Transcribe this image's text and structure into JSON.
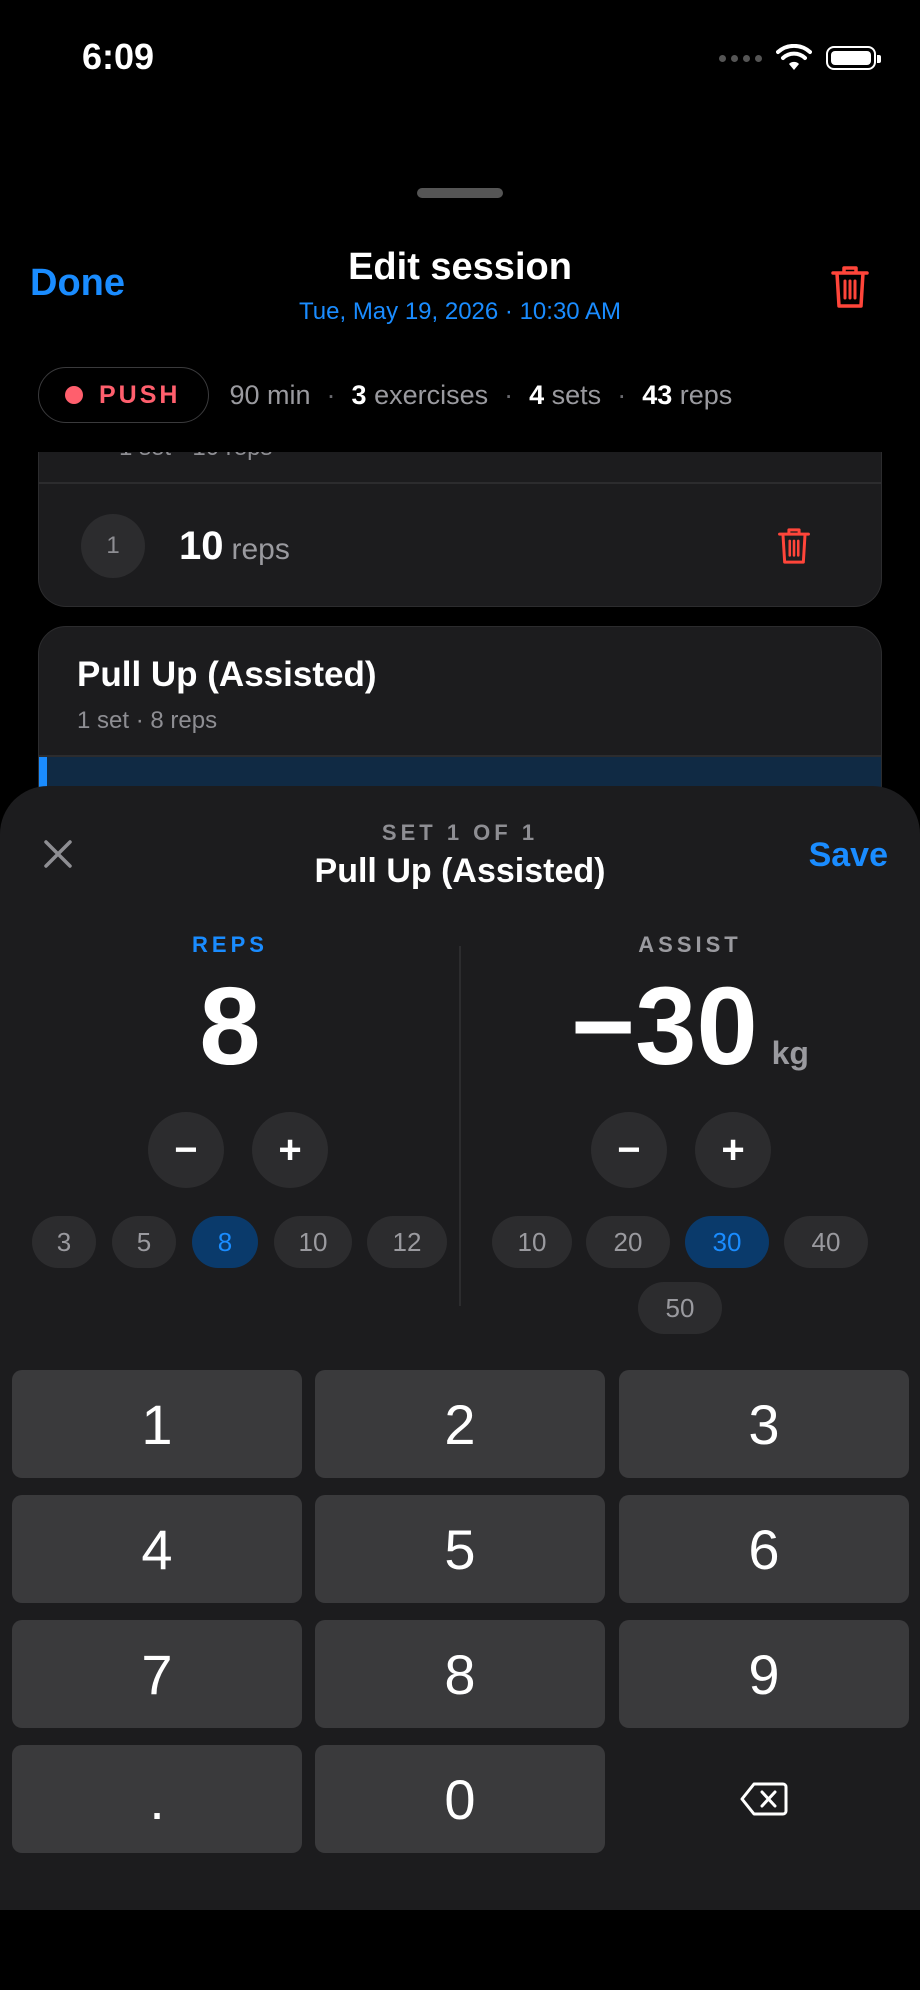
{
  "status_bar": {
    "time": "6:09"
  },
  "header": {
    "done_label": "Done",
    "title": "Edit session",
    "subtitle": "Tue, May 19, 2026 · 10:30 AM"
  },
  "summary": {
    "type_label": "PUSH",
    "duration": "90 min",
    "exercises_count": "3",
    "exercises_label": "exercises",
    "sets_count": "4",
    "sets_label": "sets",
    "reps_count": "43",
    "reps_label": "reps",
    "separator": "·"
  },
  "card_prev": {
    "subtitle_partial": "1 set · 10 reps",
    "set_number": "1",
    "set_reps_value": "10",
    "set_reps_unit": "reps"
  },
  "card_current": {
    "title": "Pull Up (Assisted)",
    "subtitle": "1 set · 8 reps"
  },
  "sheet": {
    "kicker": "SET 1 OF 1",
    "title": "Pull Up (Assisted)",
    "save_label": "Save",
    "reps": {
      "label": "REPS",
      "value": "8",
      "minus": "−",
      "plus": "+",
      "presets": [
        "3",
        "5",
        "8",
        "10",
        "12"
      ],
      "selected": "8"
    },
    "assist": {
      "label": "ASSIST",
      "value": "−30",
      "unit": "kg",
      "minus": "−",
      "plus": "+",
      "presets": [
        "10",
        "20",
        "30",
        "40",
        "50"
      ],
      "selected": "30"
    }
  },
  "keypad": {
    "keys": [
      "1",
      "2",
      "3",
      "4",
      "5",
      "6",
      "7",
      "8",
      "9",
      ".",
      "0"
    ],
    "backspace_icon": "backspace-icon"
  },
  "colors": {
    "accent": "#1a8cff",
    "destructive": "#ff453a",
    "push": "#ff5f6d",
    "background": "#000000",
    "sheet": "#1c1c1e"
  }
}
